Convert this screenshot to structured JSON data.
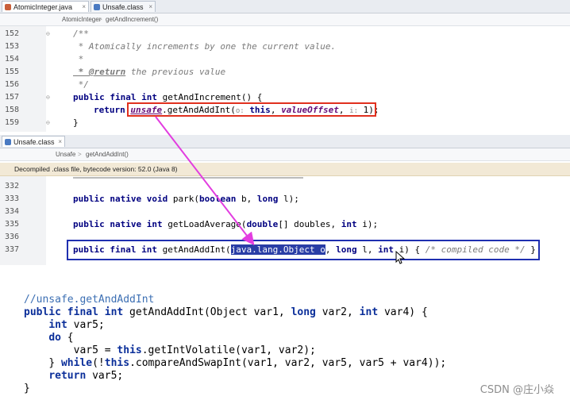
{
  "tabs_top": [
    {
      "label": "AtomicInteger.java",
      "active": true,
      "color": "#c95f3a"
    },
    {
      "label": "Unsafe.class",
      "active": false,
      "color": "#4a7ac2"
    }
  ],
  "tab_close_glyph": "×",
  "crumbs_top": [
    "AtomicInteger",
    "getAndIncrement()"
  ],
  "crumb_sep": ">",
  "editor_top": {
    "lines": [
      {
        "n": "152",
        "text": "/**"
      },
      {
        "n": "153",
        "text": " * Atomically increments by one the current value."
      },
      {
        "n": "154",
        "text": " *"
      },
      {
        "n": "155",
        "tag": " * @return",
        "text": " the previous value"
      },
      {
        "n": "156",
        "text": " */"
      },
      {
        "n": "157",
        "kw": "public final int",
        "text": " getAndIncrement() {"
      },
      {
        "n": "158",
        "kw": "return",
        "field": "unsafe",
        "call": ".getAndAddInt(",
        "hint1": "o:",
        "kw2": "this",
        "sep": ", ",
        "arg": "valueOffset",
        "sep2": ", ",
        "hint2": "i:",
        "tail": " 1);"
      },
      {
        "n": "159",
        "text": "}"
      }
    ]
  },
  "tab_bottom": {
    "label": "Unsafe.class",
    "color": "#4a7ac2"
  },
  "crumbs_bottom": [
    "Unsafe",
    "getAndAddInt()"
  ],
  "banner": "Decompiled .class file, bytecode version: 52.0 (Java 8)",
  "editor_bottom": {
    "lines": [
      {
        "n": "332",
        "kw": "",
        "text": ""
      },
      {
        "n": "333",
        "kw": "public native void",
        "text": " park(",
        "kw2": "boolean",
        "text2": " b, ",
        "kw3": "long",
        "text3": " l);"
      },
      {
        "n": "334",
        "kw": "",
        "text": ""
      },
      {
        "n": "335",
        "kw": "public native int",
        "text": " getLoadAverage(",
        "kw2": "double",
        "text2": "[] doubles, ",
        "kw3": "int",
        "text3": " i);"
      },
      {
        "n": "336",
        "kw": "",
        "text": ""
      },
      {
        "n": "337",
        "kw": "public final int",
        "text": " getAndAddInt(",
        "sel": "java.lang.Object o",
        "text2": ", ",
        "kw2": "long",
        "text3": " l, ",
        "kw3": "int",
        "text4": " i) { ",
        "cmt": "/* compiled code */",
        "tail": " }"
      }
    ]
  },
  "snippet": {
    "lines": [
      {
        "c": "//unsafe.getAndAddInt"
      },
      {
        "k1": "public final int",
        "t1": " getAndAddInt(Object var1, ",
        "k2": "long",
        "t2": " var2, ",
        "k3": "int",
        "t3": " var4) {"
      },
      {
        "indent": "    ",
        "k1": "int",
        "t1": " var5;"
      },
      {
        "indent": "    ",
        "k1": "do",
        "t1": " {"
      },
      {
        "indent": "        ",
        "t1": "var5 = ",
        "k1b": "this",
        "t2": ".getIntVolatile(var1, var2);"
      },
      {
        "indent": "    ",
        "t1": "} ",
        "k1b": "while",
        "t2": "(!",
        "k2": "this",
        "t3": ".compareAndSwapInt(var1, var2, var5, var5 + var4));"
      },
      {
        "indent": "    ",
        "k1": "return",
        "t1": " var5;"
      },
      {
        "t1": "}"
      }
    ]
  },
  "watermark": "CSDN @庄小焱",
  "colors": {
    "highlight_red": "#e0301e",
    "highlight_blue": "#1f2fb0",
    "arrow": "#e23de0"
  }
}
